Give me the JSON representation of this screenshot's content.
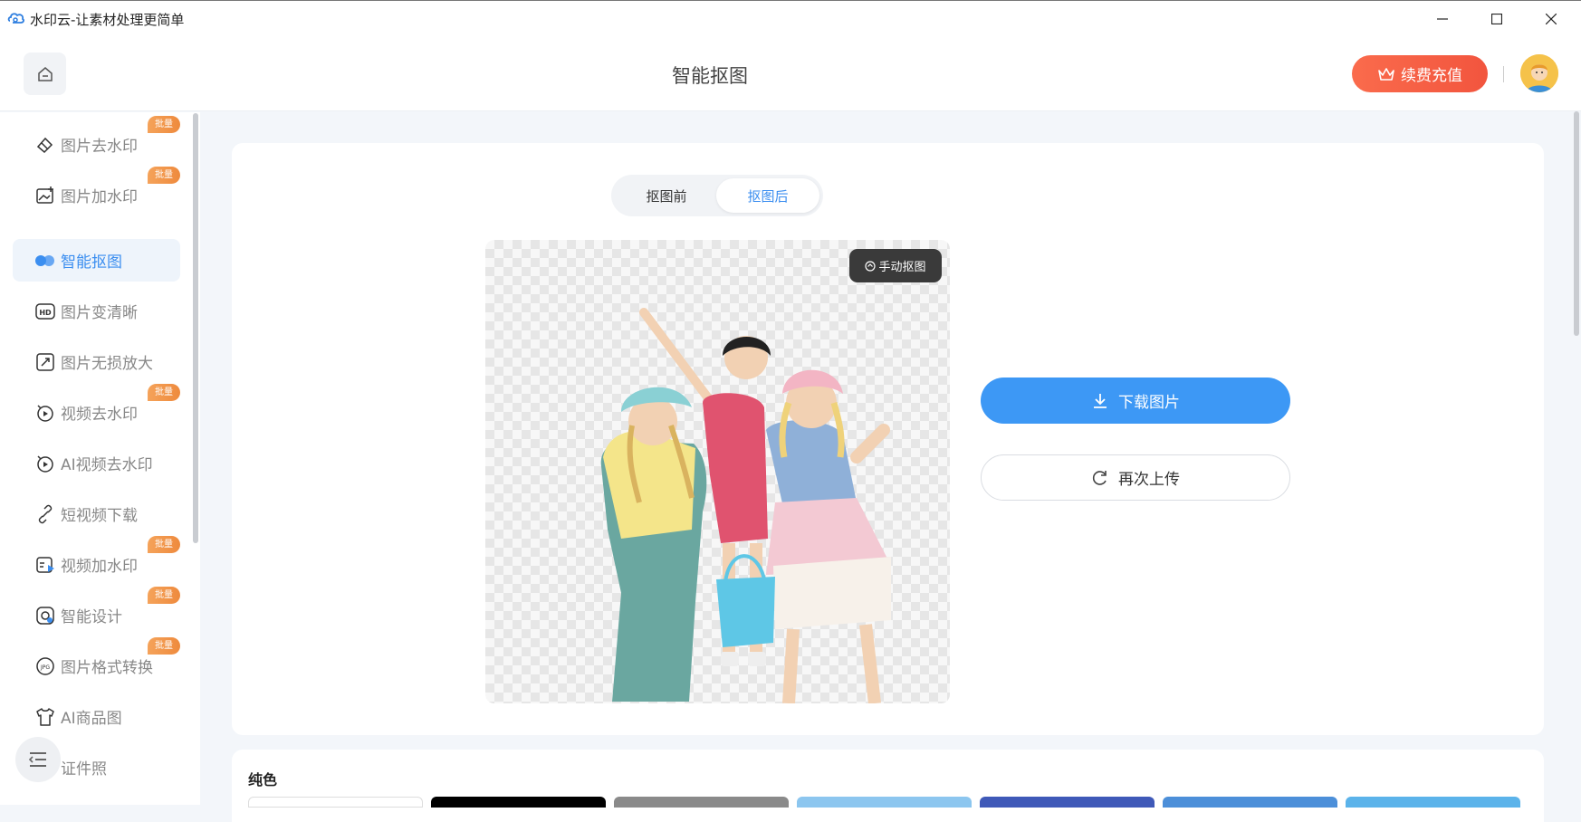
{
  "window": {
    "title": "水印云-让素材处理更简单"
  },
  "header": {
    "page_title": "智能抠图",
    "vip_label": "续费充值"
  },
  "sidebar": {
    "items": [
      {
        "label": "图片去水印",
        "badge": "批量",
        "icon": "eraser-icon"
      },
      {
        "label": "图片加水印",
        "badge": "批量",
        "icon": "image-add-icon"
      },
      {
        "label": "智能抠图",
        "badge": "",
        "icon": "cutout-icon",
        "active": true
      },
      {
        "label": "图片变清晰",
        "badge": "",
        "icon": "hd-icon"
      },
      {
        "label": "图片无损放大",
        "badge": "",
        "icon": "enlarge-icon"
      },
      {
        "label": "视频去水印",
        "badge": "批量",
        "icon": "video-eraser-icon"
      },
      {
        "label": "AI视频去水印",
        "badge": "",
        "icon": "ai-video-icon"
      },
      {
        "label": "短视频下载",
        "badge": "",
        "icon": "link-icon"
      },
      {
        "label": "视频加水印",
        "badge": "批量",
        "icon": "video-add-icon"
      },
      {
        "label": "智能设计",
        "badge": "批量",
        "icon": "design-icon"
      },
      {
        "label": "图片格式转换",
        "badge": "批量",
        "icon": "jpg-icon"
      },
      {
        "label": "AI商品图",
        "badge": "",
        "icon": "shirt-icon"
      },
      {
        "label": "证件照",
        "badge": "",
        "icon": "id-photo-icon"
      }
    ]
  },
  "tabs": {
    "before": "抠图前",
    "after": "抠图后",
    "selected": "抠图后"
  },
  "preview": {
    "manual_label": "手动抠图"
  },
  "actions": {
    "download_label": "下载图片",
    "reupload_label": "再次上传"
  },
  "backgrounds": {
    "section_title": "纯色",
    "swatches": [
      "#ffffff",
      "#000000",
      "#8a8a8a",
      "#8cc6ef",
      "#3f59b8",
      "#4c8fd9",
      "#5bb3ea"
    ]
  },
  "colors": {
    "accent": "#3d98f5",
    "vip": "#f2553e",
    "badge": "#ee8a3d"
  }
}
